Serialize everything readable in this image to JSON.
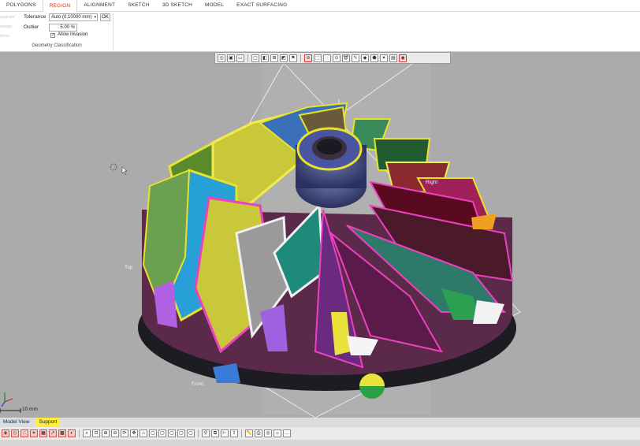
{
  "ribbon_tabs": [
    "POLYGONS",
    "REGION",
    "ALIGNMENT",
    "SKETCH",
    "3D SKETCH",
    "MODEL",
    "EXACT SURFACING"
  ],
  "active_tab_index": 1,
  "left_cut": {
    "line1": "eparate",
    "line2": "nlarge",
    "line3": "tions"
  },
  "geometry": {
    "tolerance_label": "Tolerance",
    "tolerance_value": "Auto (0.10000 mm)",
    "ok_label": "OK",
    "outlier_label": "Outlier",
    "outlier_value": "5.00 %",
    "allow_invasion_label": "Allow Invasion",
    "allow_invasion_checked": true,
    "group_label": "Geometry Classification"
  },
  "view_toolbar_icons": [
    "view-orient-icon",
    "box-view-icon",
    "display-mode-icon",
    "cube-view-icon",
    "section-view-icon",
    "plane-view-icon",
    "split-view-icon",
    "flag-icon",
    "no-select-icon",
    "rect-select-icon",
    "circle-select-icon",
    "point-select-icon",
    "lasso-icon",
    "brush-icon",
    "paint-icon",
    "region-grow-icon",
    "magic-select-icon",
    "highlight-icon",
    "visibility-eye-icon"
  ],
  "viewport": {
    "labels": {
      "top": "Top",
      "front": "Front",
      "right": "Right"
    },
    "scale": "10 mm",
    "background": "#ababab"
  },
  "bottom_tabs": [
    "Model View",
    "Support"
  ],
  "bottom_toolbar_icons": [
    "shaded-icon",
    "wireframe-icon",
    "points-icon",
    "edges-icon",
    "mesh-icon",
    "normals-icon",
    "texture-icon",
    "deviation-icon",
    "zoom-fit-icon",
    "zoom-window-icon",
    "zoom-in-icon",
    "zoom-out-icon",
    "rotate-icon",
    "pan-icon",
    "home-view-icon",
    "front-view-icon",
    "back-view-icon",
    "left-view-icon",
    "right-view-icon",
    "top-view-icon",
    "probe-icon",
    "copy-icon",
    "measure-icon",
    "export-icon",
    "ruler-icon",
    "print-icon",
    "camera-icon",
    "light-icon",
    "more-icon"
  ],
  "colors": {
    "active_tab": "#c23b23",
    "support_tab": "#ffef3a"
  }
}
